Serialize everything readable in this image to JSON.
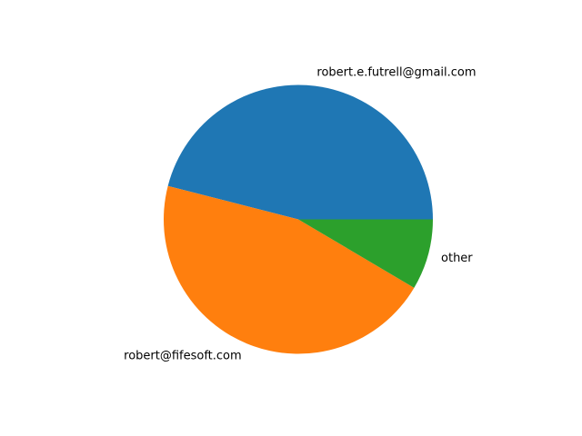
{
  "chart_data": {
    "type": "pie",
    "title": "",
    "slices": [
      {
        "label": "robert.e.futrell@gmail.com",
        "value": 46.0,
        "color": "#1f77b4"
      },
      {
        "label": "robert@fifesoft.com",
        "value": 45.5,
        "color": "#ff7f0e"
      },
      {
        "label": "other",
        "value": 8.5,
        "color": "#2ca02c"
      }
    ],
    "start_angle_deg": 0,
    "direction": "counterclockwise",
    "legend": "none"
  }
}
